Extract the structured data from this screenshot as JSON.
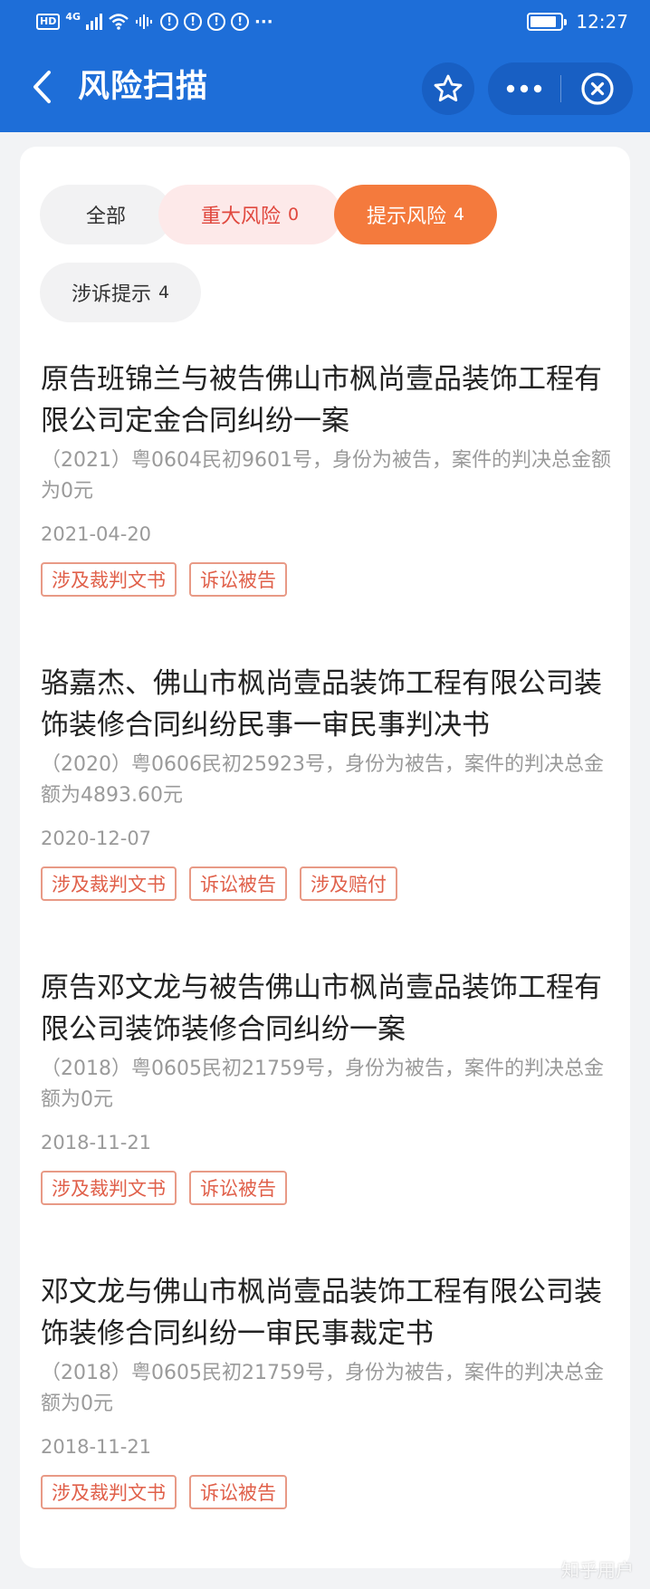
{
  "status_bar": {
    "hd": "HD",
    "network": "4G",
    "alert_glyph": "!",
    "ellipsis": "···",
    "time": "12:27",
    "battery_level": 0.85
  },
  "navbar": {
    "title": "风险扫描"
  },
  "filters": [
    {
      "label": "全部",
      "count": ""
    },
    {
      "label": "重大风险",
      "count": "0"
    },
    {
      "label": "提示风险",
      "count": "4"
    },
    {
      "label": "涉诉提示",
      "count": "4"
    }
  ],
  "items": [
    {
      "title": "原告班锦兰与被告佛山市枫尚壹品装饰工程有限公司定金合同纠纷一案",
      "desc": "（2021）粤0604民初9601号，身份为被告，案件的判决总金额为0元",
      "date": "2021-04-20",
      "tags": [
        "涉及裁判文书",
        "诉讼被告"
      ]
    },
    {
      "title": "骆嘉杰、佛山市枫尚壹品装饰工程有限公司装饰装修合同纠纷民事一审民事判决书",
      "desc": "（2020）粤0606民初25923号，身份为被告，案件的判决总金额为4893.60元",
      "date": "2020-12-07",
      "tags": [
        "涉及裁判文书",
        "诉讼被告",
        "涉及赔付"
      ]
    },
    {
      "title": "原告邓文龙与被告佛山市枫尚壹品装饰工程有限公司装饰装修合同纠纷一案",
      "desc": "（2018）粤0605民初21759号，身份为被告，案件的判决总金额为0元",
      "date": "2018-11-21",
      "tags": [
        "涉及裁判文书",
        "诉讼被告"
      ]
    },
    {
      "title": "邓文龙与佛山市枫尚壹品装饰工程有限公司装饰装修合同纠纷一审民事裁定书",
      "desc": "（2018）粤0605民初21759号，身份为被告，案件的判决总金额为0元",
      "date": "2018-11-21",
      "tags": [
        "涉及裁判文书",
        "诉讼被告"
      ]
    }
  ],
  "watermark": "知乎用户",
  "colors": {
    "nav_blue": "#1e6ed8",
    "accent_orange": "#f47a3d",
    "risk_red": "#e0483e",
    "tag_orange": "#e0604a"
  }
}
